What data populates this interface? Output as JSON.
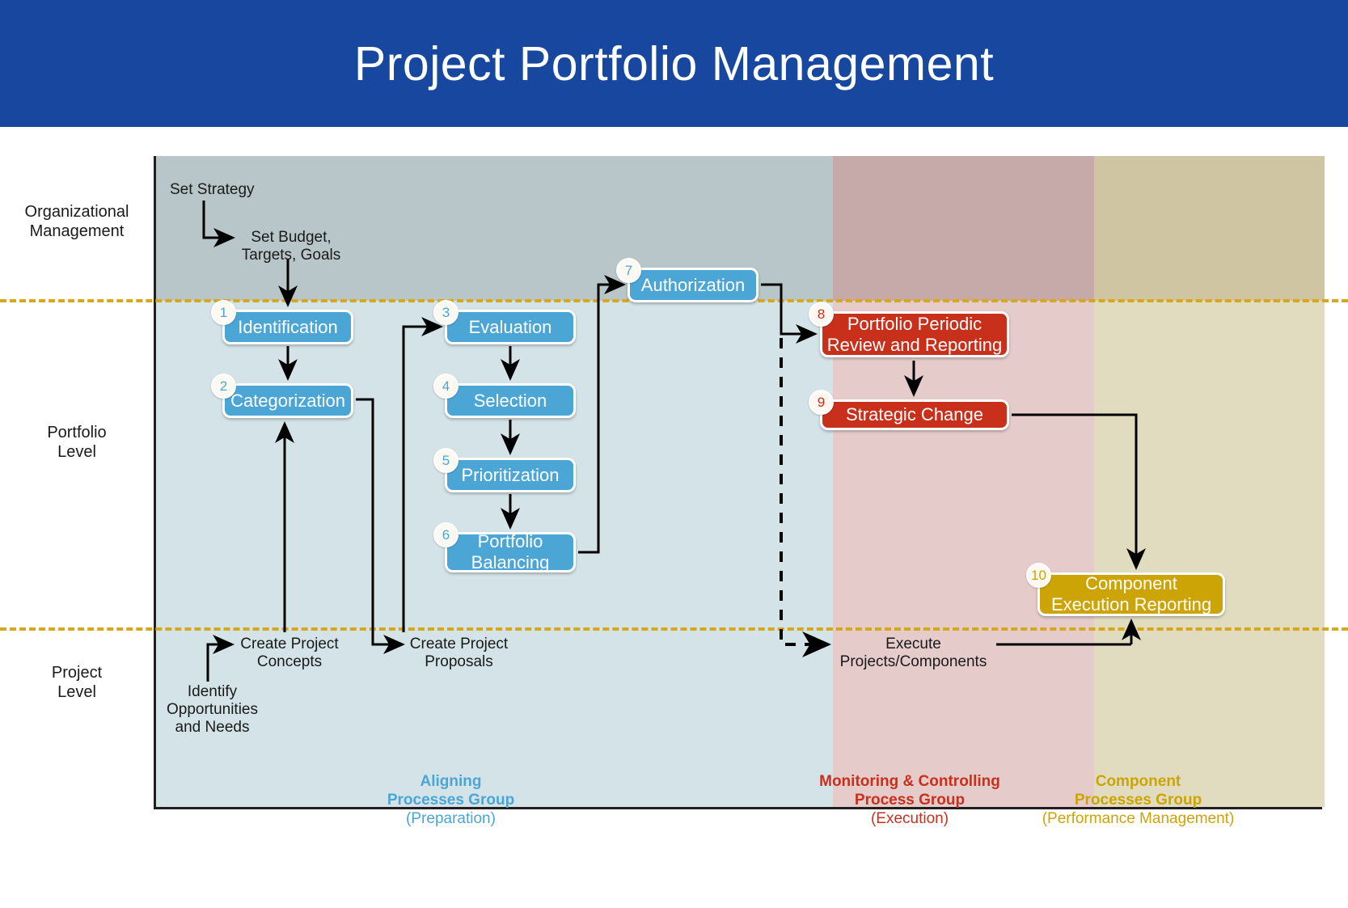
{
  "header": {
    "title": "Project Portfolio Management"
  },
  "row_labels": [
    {
      "id": "organizational",
      "text": "Organizational\nManagement"
    },
    {
      "id": "portfolio",
      "text": "Portfolio\nLevel"
    },
    {
      "id": "project",
      "text": "Project\nLevel"
    }
  ],
  "row_labels_flat": {
    "organizational_line1": "Organizational",
    "organizational_line2": "Management",
    "portfolio_line1": "Portfolio",
    "portfolio_line2": "Level",
    "project_line1": "Project",
    "project_line2": "Level"
  },
  "annotations": {
    "set_strategy": "Set Strategy",
    "set_budget_line1": "Set Budget,",
    "set_budget_line2": "Targets, Goals",
    "create_concepts_line1": "Create Project",
    "create_concepts_line2": "Concepts",
    "identify_line1": "Identify",
    "identify_line2": "Opportunities",
    "identify_line3": "and Needs",
    "create_proposals_line1": "Create Project",
    "create_proposals_line2": "Proposals",
    "execute_line1": "Execute",
    "execute_line2": "Projects/Components"
  },
  "boxes": [
    {
      "number": "1",
      "label": "Identification",
      "color": "blue",
      "lane": "portfolio",
      "group": "aligning"
    },
    {
      "number": "2",
      "label": "Categorization",
      "color": "blue",
      "lane": "portfolio",
      "group": "aligning"
    },
    {
      "number": "3",
      "label": "Evaluation",
      "color": "blue",
      "lane": "portfolio",
      "group": "aligning"
    },
    {
      "number": "4",
      "label": "Selection",
      "color": "blue",
      "lane": "portfolio",
      "group": "aligning"
    },
    {
      "number": "5",
      "label": "Prioritization",
      "color": "blue",
      "lane": "portfolio",
      "group": "aligning"
    },
    {
      "number": "6",
      "label": "Portfolio Balancing",
      "color": "blue",
      "lane": "portfolio",
      "group": "aligning"
    },
    {
      "number": "7",
      "label": "Authorization",
      "color": "blue",
      "lane": "portfolio",
      "group": "aligning"
    },
    {
      "number": "8",
      "label": "Portfolio Periodic Review and Reporting",
      "color": "red",
      "lane": "portfolio",
      "group": "monitoring"
    },
    {
      "number": "9",
      "label": "Strategic Change",
      "color": "red",
      "lane": "portfolio",
      "group": "monitoring"
    },
    {
      "number": "10",
      "label": "Component Execution Reporting",
      "color": "gold",
      "lane": "project",
      "group": "component"
    }
  ],
  "box_text": {
    "b1": "Identification",
    "b2": "Categorization",
    "b3": "Evaluation",
    "b4": "Selection",
    "b5": "Prioritization",
    "b6_line1": "Portfolio",
    "b6_line2": "Balancing",
    "b7": "Authorization",
    "b8_line1": "Portfolio Periodic",
    "b8_line2": "Review and Reporting",
    "b9": "Strategic Change",
    "b10_line1": "Component",
    "b10_line2": "Execution Reporting"
  },
  "box_numbers": {
    "n1": "1",
    "n2": "2",
    "n3": "3",
    "n4": "4",
    "n5": "5",
    "n6": "6",
    "n7": "7",
    "n8": "8",
    "n9": "9",
    "n10": "10"
  },
  "groups": [
    {
      "id": "aligning",
      "line1": "Aligning",
      "line2": "Processes Group",
      "line3": "(Preparation)",
      "color": "#4ba6d6"
    },
    {
      "id": "monitoring",
      "line1": "Monitoring & Controlling",
      "line2": "Process Group",
      "line3": "(Execution)",
      "color": "#c9301c"
    },
    {
      "id": "component",
      "line1": "Component",
      "line2": "Processes Group",
      "line3": "(Performance Management)",
      "color": "#cda405"
    }
  ],
  "colors": {
    "header_blue": "#17479e",
    "box_blue": "#4ba6d6",
    "box_red": "#c9301c",
    "box_gold": "#cda405",
    "dash_gold": "#d6a81a",
    "band_aligning_upper": "#b9c6c9",
    "band_aligning_lower": "#d3e3e8",
    "band_monitoring_upper": "#c6aaaa",
    "band_monitoring_lower": "#e6cbcb",
    "band_component_upper": "#cfc5a2",
    "band_component_lower": "#e1dcc0",
    "connector": "#000000"
  }
}
